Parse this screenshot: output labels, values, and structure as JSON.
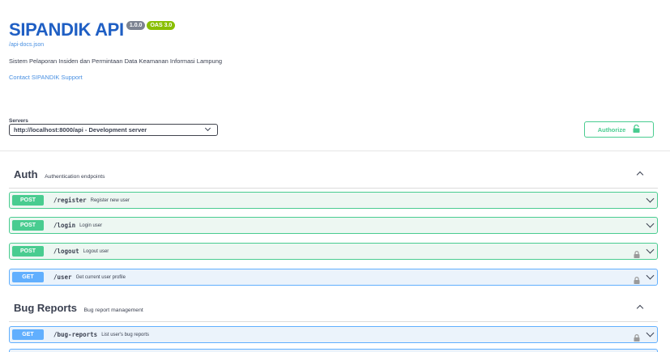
{
  "info": {
    "title": "SIPANDIK API",
    "version": "1.0.0",
    "oas": "OAS 3.0",
    "spec_url": "/api-docs.json",
    "description": "Sistem Pelaporan Insiden dan Permintaan Data Keamanan Informasi Lampung",
    "contact": "Contact SIPANDIK Support"
  },
  "servers": {
    "label": "Servers",
    "selected": "http://localhost:8000/api - Development server"
  },
  "authorize": {
    "label": "Authorize",
    "color": "#49cc90"
  },
  "sections": [
    {
      "name": "Auth",
      "description": "Authentication endpoints",
      "operations": [
        {
          "method": "POST",
          "path": "/register",
          "summary": "Register new user",
          "locked": false
        },
        {
          "method": "POST",
          "path": "/login",
          "summary": "Login user",
          "locked": false
        },
        {
          "method": "POST",
          "path": "/logout",
          "summary": "Logout user",
          "locked": true
        },
        {
          "method": "GET",
          "path": "/user",
          "summary": "Get current user profile",
          "locked": true
        }
      ]
    },
    {
      "name": "Bug Reports",
      "description": "Bug report management",
      "operations": [
        {
          "method": "GET",
          "path": "/bug-reports",
          "summary": "List user's bug reports",
          "locked": true
        }
      ]
    }
  ],
  "colors": {
    "post": "#49cc90",
    "get": "#61affe",
    "title": "#1f5fc4",
    "link": "#4990e2"
  }
}
